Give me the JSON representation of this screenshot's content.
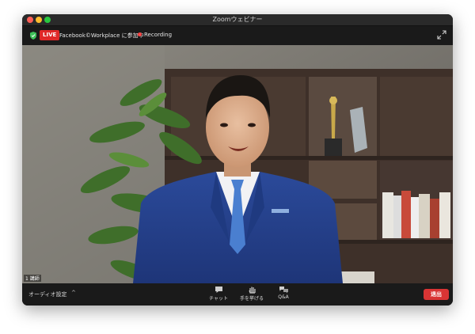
{
  "window": {
    "title": "Zoomウェビナー"
  },
  "infobar": {
    "live_label": "LIVE",
    "meeting_text": "Facebook©Workplace に参加中",
    "recording_label": "Recording"
  },
  "video": {
    "participant_count": "1 講師"
  },
  "toolbar": {
    "audio_label": "オーディオ設定",
    "audio_caret": "^",
    "chat_label": "チャット",
    "raise_hand_label": "手を挙げる",
    "qa_label": "Q&A",
    "leave_label": "退出"
  },
  "colors": {
    "live_red": "#e02828",
    "leave_red": "#d93434",
    "toolbar_bg": "#1a1a1a",
    "recording_dot": "#ff4444"
  },
  "icons": [
    "shield-icon",
    "expand-icon",
    "chat-icon",
    "raise-hand-icon",
    "qa-icon"
  ]
}
